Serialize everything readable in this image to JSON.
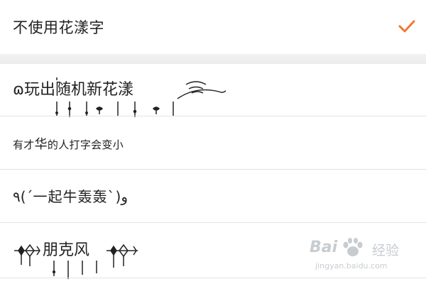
{
  "options": {
    "none": {
      "label": "不使用花漾字",
      "selected": true
    },
    "items": [
      {
        "label": "ɷ玩出随机新花漾"
      },
      {
        "label": "有才",
        "label_big": "华",
        "label_rest": "的人打字会变小"
      },
      {
        "label": "٩(ˊ一起牛轰轰ˋ)و"
      },
      {
        "label": "朋克风"
      }
    ]
  },
  "accent_color": "#f07a2e",
  "watermark": {
    "logo": "Bai",
    "cn": "经验",
    "url": "jingyan.baidu.com"
  }
}
